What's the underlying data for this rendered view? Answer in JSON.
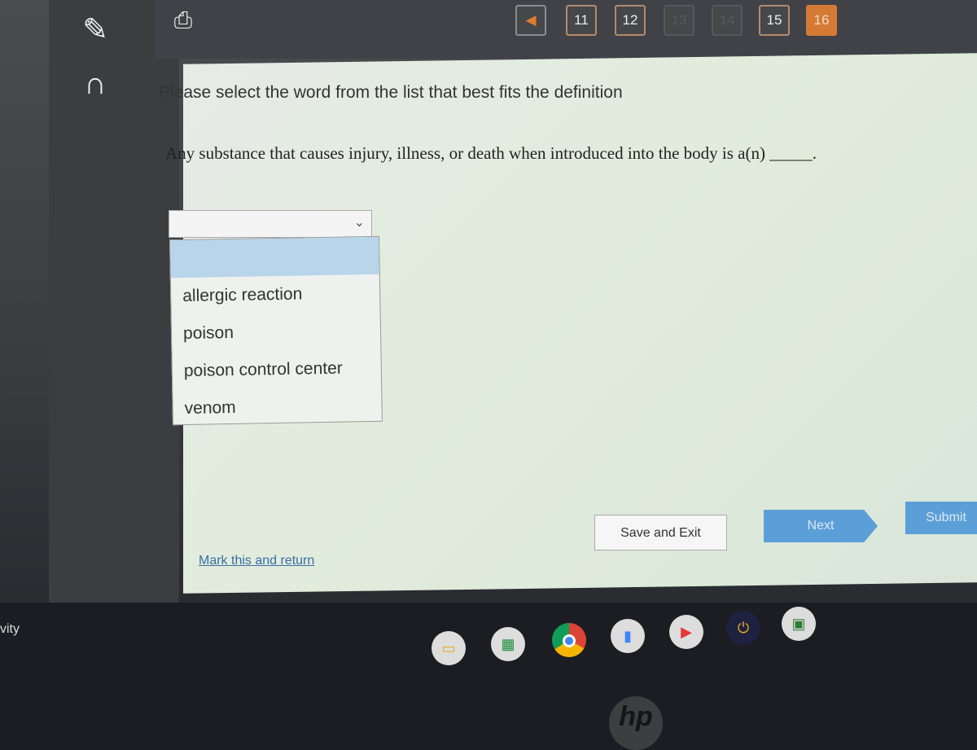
{
  "pagination": {
    "prev_icon": "triangle-left-icon",
    "pages": [
      {
        "label": "11",
        "state": "answered"
      },
      {
        "label": "12",
        "state": "answered"
      },
      {
        "label": "13",
        "state": "dim"
      },
      {
        "label": "14",
        "state": "dim"
      },
      {
        "label": "15",
        "state": "answered"
      },
      {
        "label": "16",
        "state": "current"
      }
    ]
  },
  "tools": [
    "pencil-icon",
    "headphones-icon",
    "print-icon"
  ],
  "instruction": "Please select the word from the list that best fits the definition",
  "question": "Any substance that causes injury, illness, or death when introduced into the body is a(n) _____.",
  "dropdown": {
    "selected": "",
    "options": [
      "allergic reaction",
      "poison",
      "poison control center",
      "venom"
    ]
  },
  "buttons": {
    "save": "Save and Exit",
    "next": "Next",
    "submit": "Submit"
  },
  "mark_link": "Mark this and return",
  "side_text": "vity",
  "dock": [
    "slides-icon",
    "sheets-icon",
    "chrome-icon",
    "docs-icon",
    "youtube-icon",
    "power-icon",
    "classroom-icon"
  ],
  "logo": "hp",
  "colors": {
    "current_page": "#d57a35",
    "button": "#5b9fd8",
    "highlight": "#b9d5ea"
  }
}
